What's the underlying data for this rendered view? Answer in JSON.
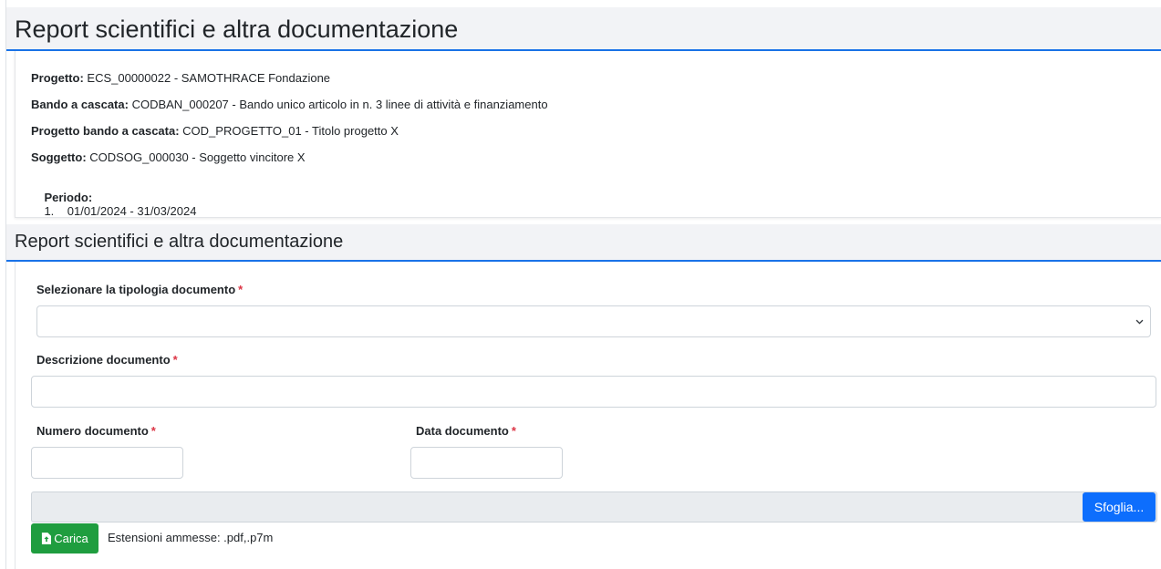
{
  "page": {
    "title": "Report scientifici e altra documentazione"
  },
  "info": {
    "progetto": {
      "label": "Progetto:",
      "value": "ECS_00000022 - SAMOTHRACE Fondazione"
    },
    "bando": {
      "label": "Bando a cascata:",
      "value": "CODBAN_000207 - Bando unico articolo in n. 3 linee di attività e finanziamento"
    },
    "progetto_bando": {
      "label": "Progetto bando a cascata:",
      "value": "COD_PROGETTO_01 - Titolo progetto X"
    },
    "soggetto": {
      "label": "Soggetto:",
      "value": "CODSOG_000030 - Soggetto vincitore X"
    },
    "periodo": {
      "label": "Periodo:",
      "value": "1.    01/01/2024 - 31/03/2024"
    }
  },
  "section": {
    "title": "Report scientifici e altra documentazione"
  },
  "form": {
    "tipologia": {
      "label": "Selezionare la tipologia documento",
      "value": ""
    },
    "descrizione": {
      "label": "Descrizione documento",
      "value": ""
    },
    "numero": {
      "label": "Numero documento",
      "value": ""
    },
    "data": {
      "label": "Data documento",
      "value": ""
    },
    "required_mark": "*",
    "browse_label": "Sfoglia...",
    "upload_label": "Carica",
    "extensions_text": "Estensioni ammesse: .pdf,.p7m"
  },
  "colors": {
    "accent": "#1a73e8",
    "primary_button": "#0d6efd",
    "success_button": "#1f9d3f",
    "required": "#dc3545"
  },
  "icons": {
    "select": "chevron-down-icon",
    "upload": "file-upload-icon"
  }
}
